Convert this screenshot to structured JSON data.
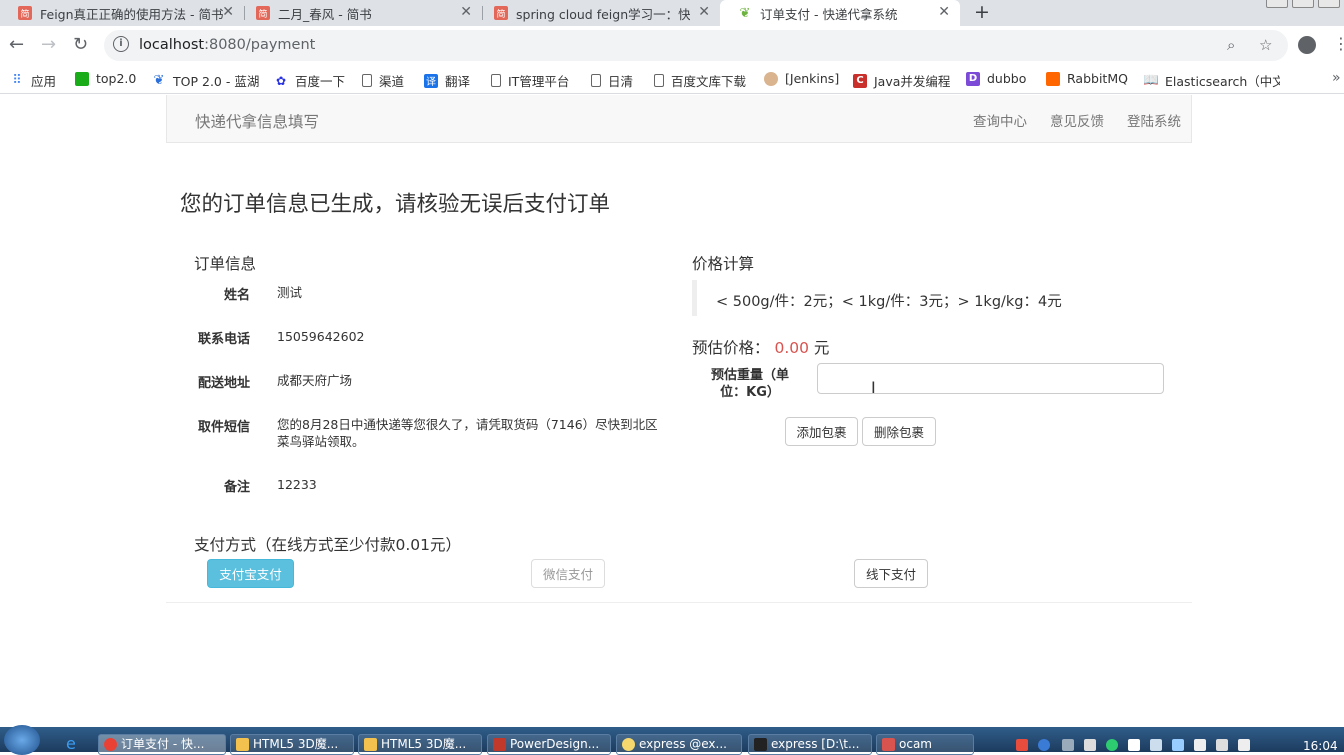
{
  "browser": {
    "tabs": [
      {
        "title": "Feign真正正确的使用方法 - 简书",
        "favicon": "简"
      },
      {
        "title": "二月_春风 - 简书",
        "favicon": "简"
      },
      {
        "title": "spring cloud feign学习一：快速",
        "favicon": "简"
      },
      {
        "title": "订单支付 - 快递代拿系统",
        "favicon": "leaf-icon"
      }
    ],
    "url_host": "localhost",
    "url_rest": ":8080/payment"
  },
  "bookmarks": [
    {
      "label": "应用",
      "icon": "apps-grid-icon"
    },
    {
      "label": "top2.0",
      "icon": "green-square-icon"
    },
    {
      "label": "TOP 2.0 - 蓝湖",
      "icon": "lanhu-icon"
    },
    {
      "label": "百度一下",
      "icon": "baidu-paw-icon"
    },
    {
      "label": "渠道",
      "icon": "page-icon"
    },
    {
      "label": "翻译",
      "icon": "translate-icon"
    },
    {
      "label": "IT管理平台",
      "icon": "page-icon"
    },
    {
      "label": "日清",
      "icon": "page-icon"
    },
    {
      "label": "百度文库下载",
      "icon": "page-icon"
    },
    {
      "label": "[Jenkins]",
      "icon": "jenkins-icon"
    },
    {
      "label": "Java并发编程",
      "icon": "csdn-icon"
    },
    {
      "label": "dubbo",
      "icon": "dubbo-icon"
    },
    {
      "label": "RabbitMQ",
      "icon": "rabbitmq-icon"
    },
    {
      "label": "Elasticsearch（中文",
      "icon": "book-icon"
    }
  ],
  "navbar": {
    "brand": "快递代拿信息填写",
    "links": [
      "查询中心",
      "意见反馈",
      "登陆系统"
    ]
  },
  "main": {
    "title": "您的订单信息已生成，请核验无误后支付订单",
    "order_heading": "订单信息",
    "order": [
      {
        "label": "姓名",
        "value": "测试"
      },
      {
        "label": "联系电话",
        "value": "15059642602"
      },
      {
        "label": "配送地址",
        "value": "成都天府广场"
      },
      {
        "label": "取件短信",
        "value": "您的8月28日中通快递等您很久了，请凭取货码（7146）尽快到北区菜鸟驿站领取。"
      },
      {
        "label": "备注",
        "value": "12233"
      }
    ],
    "price_heading": "价格计算",
    "price_rule": "< 500g/件：2元；< 1kg/件：3元；> 1kg/kg：4元",
    "estimate_label": "预估价格：",
    "estimate_value": "0.00",
    "estimate_unit": "元",
    "weight_label": "预估重量（单位：KG）",
    "weight_value": "",
    "add_package": "添加包裹",
    "remove_package": "删除包裹",
    "payment_heading": "支付方式（在线方式至少付款0.01元）",
    "pay_alipay": "支付宝支付",
    "pay_wechat": "微信支付",
    "pay_offline": "线下支付"
  },
  "taskbar": {
    "items": [
      "订单支付 - 快...",
      "HTML5 3D魔...",
      "HTML5 3D魔...",
      "PowerDesign...",
      "express @ex...",
      "express [D:\\t...",
      "ocam"
    ],
    "clock": "16:04"
  }
}
